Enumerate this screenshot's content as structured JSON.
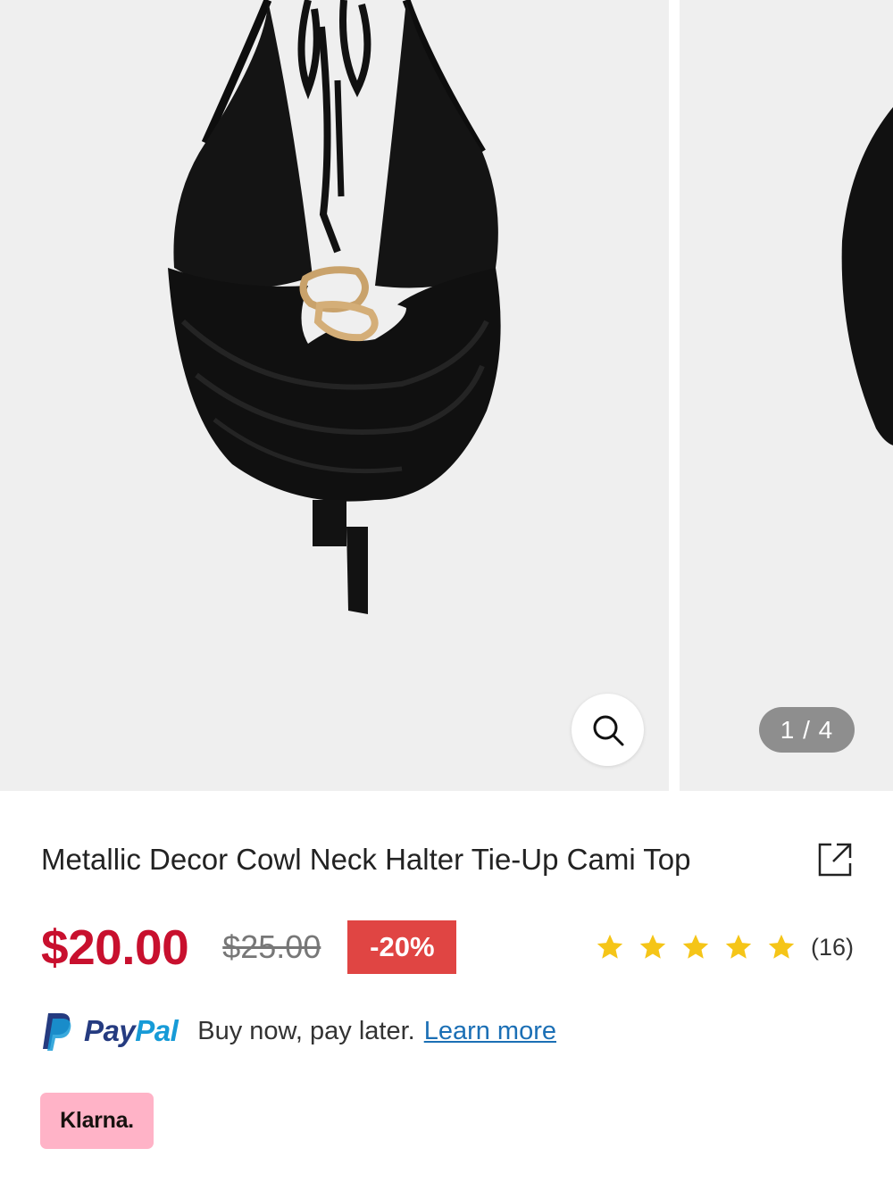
{
  "gallery": {
    "counter_text": "1 / 4",
    "zoom_icon": "search-icon"
  },
  "product": {
    "title": "Metallic Decor Cowl Neck Halter Tie-Up Cami Top",
    "share_icon": "external-link-icon",
    "price": "$20.00",
    "original_price": "$25.00",
    "discount": "-20%",
    "rating": 5,
    "rating_max": 5,
    "review_count": "(16)"
  },
  "payments": {
    "paypal_pay": "Pay",
    "paypal_pal": "Pal",
    "paypal_text": "Buy now, pay later.",
    "learn_more": "Learn more",
    "klarna_label": "Klarna."
  },
  "colors": {
    "price_red": "#c8102e",
    "discount_bg": "#e04543",
    "star_yellow": "#f5c518",
    "paypal_dark": "#253b80",
    "paypal_light": "#179bd7",
    "link_blue": "#1b6fb5",
    "klarna_pink": "#ffb3c7"
  }
}
